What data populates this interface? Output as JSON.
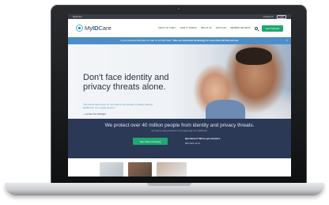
{
  "utility_bar": {
    "brand": "MyIDCare",
    "links": [
      "Contact Us",
      "Login"
    ]
  },
  "header": {
    "logo_text_prefix": "My",
    "logo_text_strong": "ID",
    "logo_text_suffix": "Care",
    "nav": [
      "About ID Theft",
      "How It Works",
      "About Us",
      "Articles",
      "Member Reviews"
    ],
    "search_icon": "search-icon",
    "cta": "Get Protected"
  },
  "banner": {
    "text": "Is your personal information for sale on the Dark Web?",
    "link": "Take our CyberScan technology for a test drive and find out now."
  },
  "hero": {
    "title": "Don't face identity and privacy threats alone.",
    "quote": "\"We would have been on the hook for thousands of dollars without MyIDCare. It's a great service.\"",
    "cite": "—member Tom Michigan"
  },
  "stats": {
    "heading": "We protect over 40 million people from identity and privacy threats.",
    "subheading": "Get best-in-class protection for the digital age from MyIDCare.",
    "plans_button": "See Plans & Pricing",
    "contact_question": "Questions? We've got answers.",
    "contact_phone": "800-939-4170"
  },
  "colors": {
    "accent_green": "#1fa86f",
    "banner_blue": "#4b8ec9",
    "navy": "#2b3856"
  }
}
